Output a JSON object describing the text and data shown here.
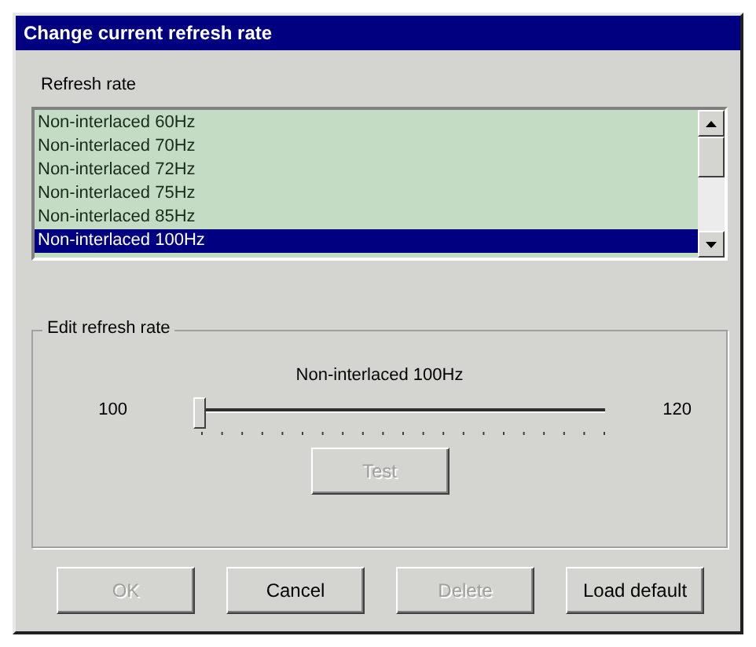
{
  "window": {
    "title": "Change current refresh rate"
  },
  "list": {
    "label": "Refresh rate",
    "items": [
      {
        "text": "Non-interlaced 60Hz",
        "selected": false
      },
      {
        "text": "Non-interlaced 70Hz",
        "selected": false
      },
      {
        "text": "Non-interlaced 72Hz",
        "selected": false
      },
      {
        "text": "Non-interlaced 75Hz",
        "selected": false
      },
      {
        "text": "Non-interlaced 85Hz",
        "selected": false
      },
      {
        "text": "Non-interlaced 100Hz",
        "selected": true
      }
    ]
  },
  "edit_group": {
    "title": "Edit refresh rate",
    "current": "Non-interlaced 100Hz",
    "min": "100",
    "max": "120",
    "slider": {
      "level": 0
    },
    "test_button": {
      "label": "Test",
      "disabled": true
    }
  },
  "buttons": [
    {
      "label": "OK",
      "disabled": true
    },
    {
      "label": "Cancel",
      "disabled": false
    },
    {
      "label": "Delete",
      "disabled": true
    },
    {
      "label": "Load default",
      "disabled": false
    }
  ]
}
